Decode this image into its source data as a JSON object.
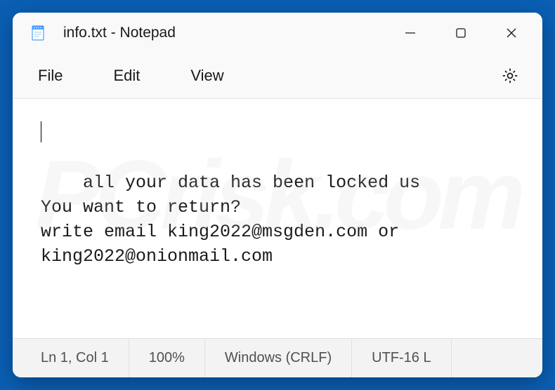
{
  "titlebar": {
    "title": "info.txt - Notepad"
  },
  "menu": {
    "file": "File",
    "edit": "Edit",
    "view": "View"
  },
  "editor": {
    "content": "all your data has been locked us\nYou want to return?\nwrite email king2022@msgden.com or king2022@onionmail.com"
  },
  "statusbar": {
    "position": "Ln 1, Col 1",
    "zoom": "100%",
    "lineending": "Windows (CRLF)",
    "encoding": "UTF-16 L"
  },
  "watermark": "PCrisk.com"
}
